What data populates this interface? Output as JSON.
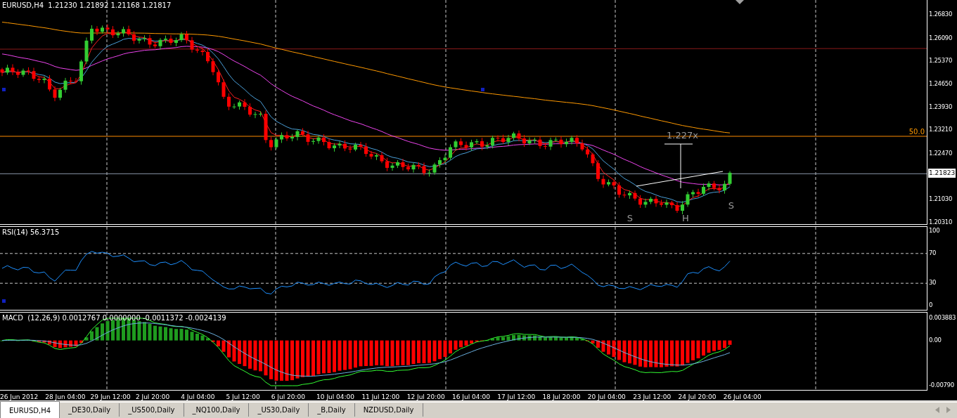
{
  "header": {
    "symbol": "EURUSD,H4",
    "prices": [
      "1.21230",
      "1.21892",
      "1.21168",
      "1.21817"
    ]
  },
  "price_axis": {
    "labels": [
      "1.26830",
      "1.26090",
      "1.25370",
      "1.24650",
      "1.23930",
      "1.23210",
      "1.22470",
      "1.21030",
      "1.20310"
    ],
    "current_price": "1.21823"
  },
  "annotations": {
    "level_label": "50.0",
    "measure_label": "1.227x",
    "pattern_marks": [
      "S",
      "H",
      "S"
    ]
  },
  "rsi": {
    "title": "RSI(14) 56.3715",
    "axis": [
      "100",
      "70",
      "30",
      "0"
    ]
  },
  "macd": {
    "title": "MACD  (12,26,9) 0.0012767 0.0000000 -0.0011372 -0.0024139",
    "axis": [
      "0.003883",
      "0.00",
      "-0.00790"
    ]
  },
  "time_axis": [
    "26 Jun 2012",
    "28 Jun 04:00",
    "29 Jun 12:00",
    "2 Jul 20:00",
    "4 Jul 04:00",
    "5 Jul 12:00",
    "6 Jul 20:00",
    "10 Jul 04:00",
    "11 Jul 12:00",
    "12 Jul 20:00",
    "16 Jul 04:00",
    "17 Jul 12:00",
    "18 Jul 20:00",
    "20 Jul 04:00",
    "23 Jul 12:00",
    "24 Jul 20:00",
    "26 Jul 04:00"
  ],
  "tabs": [
    {
      "label": "EURUSD,H4",
      "selected": true
    },
    {
      "label": "_DE30,Daily",
      "selected": false
    },
    {
      "label": "_US500,Daily",
      "selected": false
    },
    {
      "label": "_NQ100,Daily",
      "selected": false
    },
    {
      "label": "_US30,Daily",
      "selected": false
    },
    {
      "label": "_B,Daily",
      "selected": false
    },
    {
      "label": "NZDUSD,Daily",
      "selected": false
    }
  ]
}
